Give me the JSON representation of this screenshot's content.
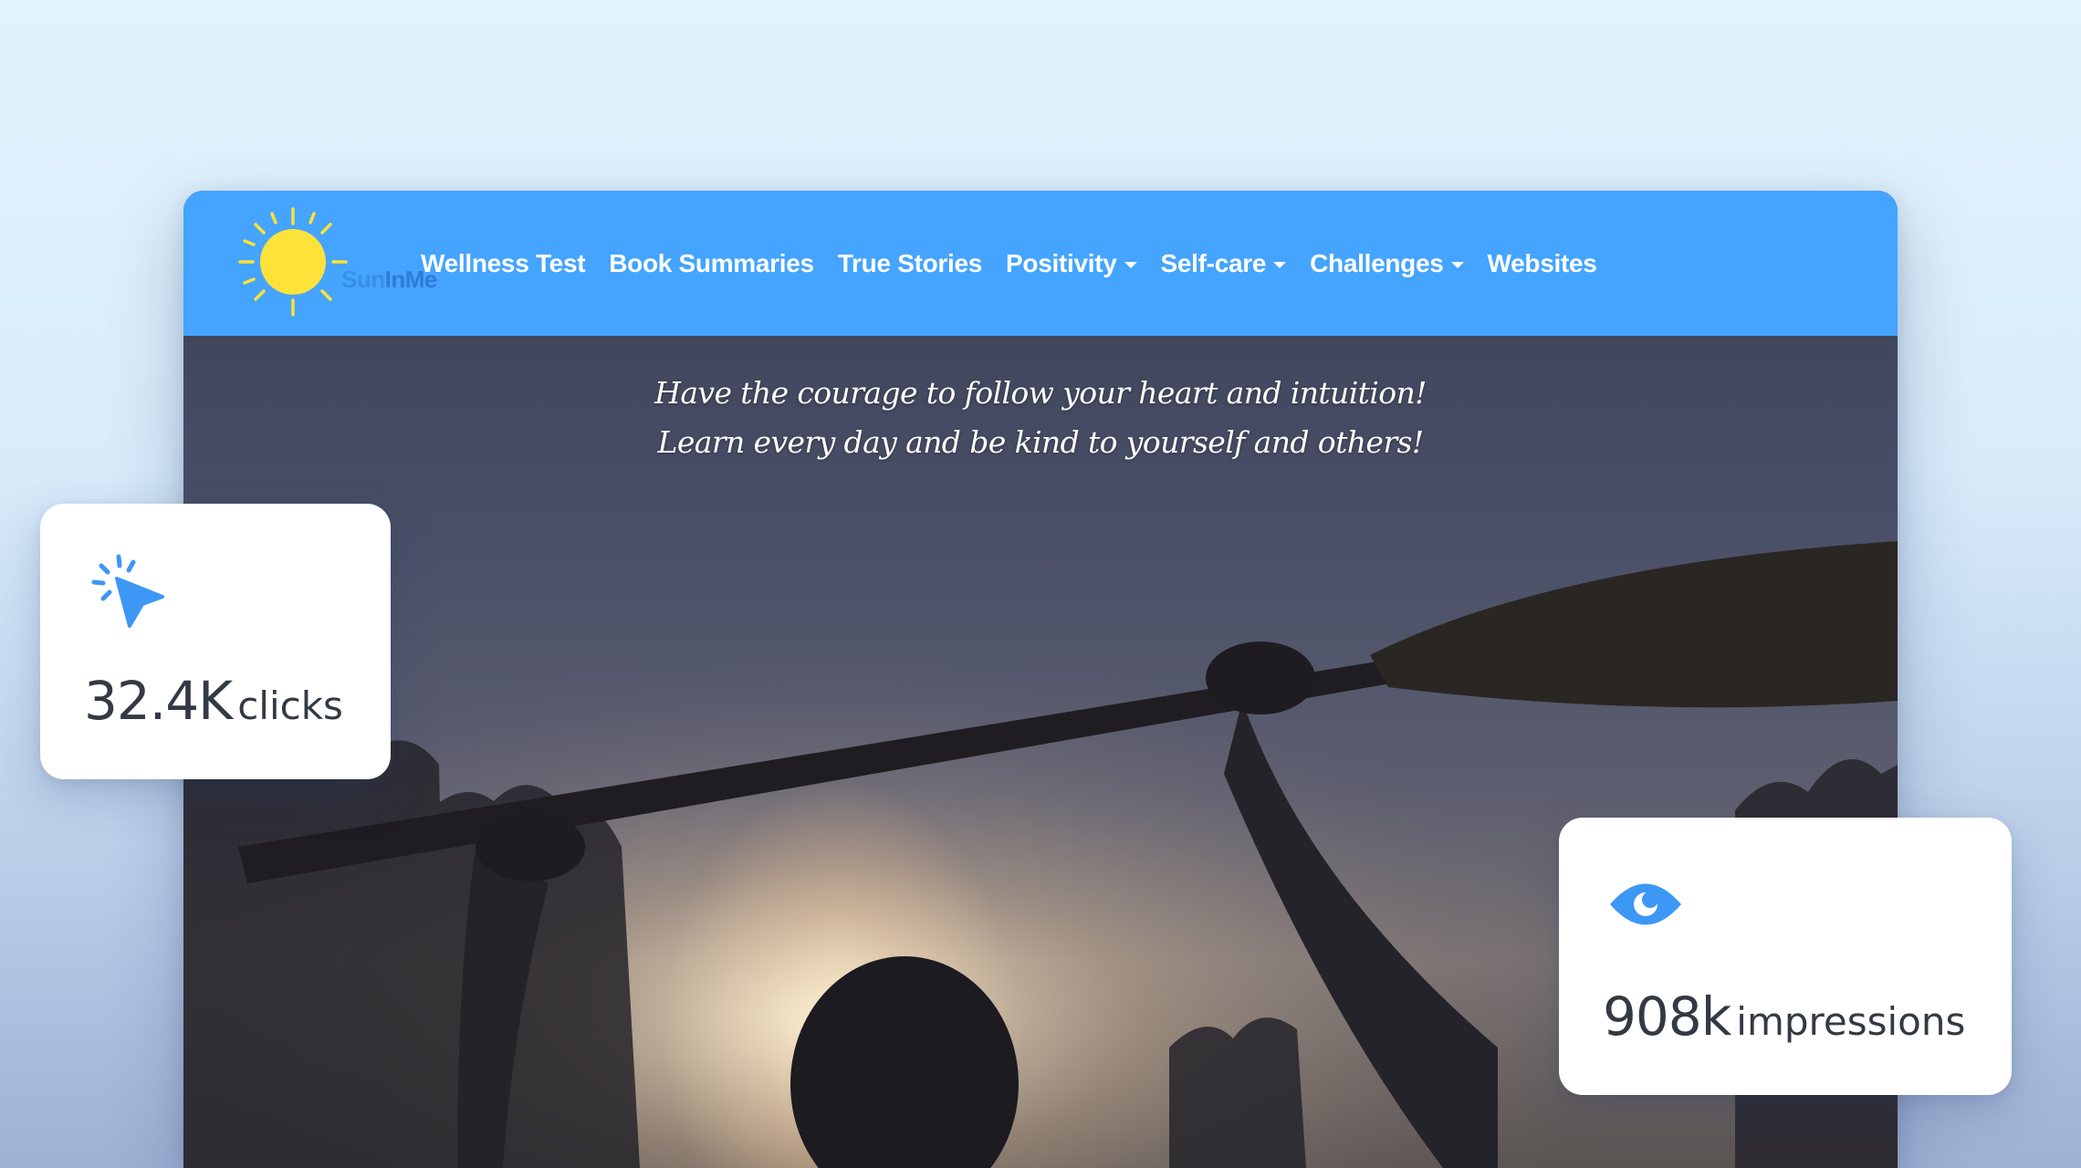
{
  "site": {
    "logo_text_a": "Sun",
    "logo_text_b": "InMe",
    "nav": [
      {
        "label": "Wellness Test",
        "dropdown": false
      },
      {
        "label": "Book Summaries",
        "dropdown": false
      },
      {
        "label": "True Stories",
        "dropdown": false
      },
      {
        "label": "Positivity",
        "dropdown": true
      },
      {
        "label": "Self-care",
        "dropdown": true
      },
      {
        "label": "Challenges",
        "dropdown": true
      },
      {
        "label": "Websites",
        "dropdown": false
      }
    ],
    "quote_line_1": "Have the courage to follow your heart and intuition!",
    "quote_line_2": "Learn every day and be kind to yourself and others!"
  },
  "stats": {
    "clicks_value": "32.4K",
    "clicks_unit": "clicks",
    "impressions_value": "908k",
    "impressions_unit": "impressions"
  },
  "colors": {
    "navbar": "#44a4ff",
    "icon_blue": "#3d97f5",
    "sun_yellow": "#fde23a",
    "stat_text": "#333a44"
  },
  "icons": {
    "logo": "sun-icon",
    "clicks": "cursor-click-icon",
    "impressions": "eye-icon"
  }
}
